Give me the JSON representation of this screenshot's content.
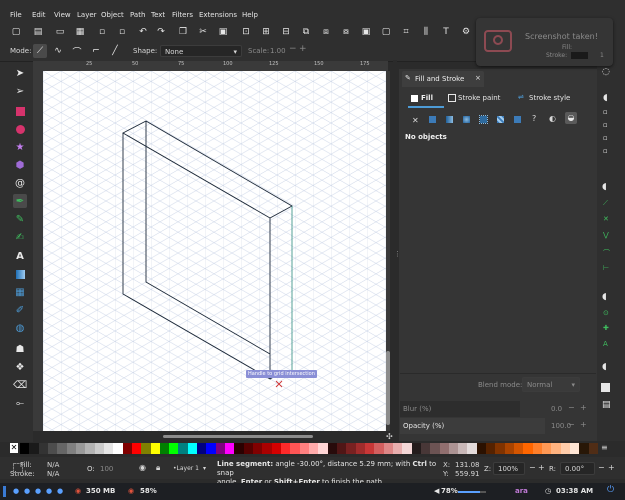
{
  "menubar": {
    "items": [
      "File",
      "Edit",
      "View",
      "Layer",
      "Object",
      "Path",
      "Text",
      "Filters",
      "Extensions",
      "Help"
    ]
  },
  "tool_controls": {
    "mode_label": "Mode:",
    "shape_label": "Shape:",
    "shape_value": "None",
    "scale_label": "Scale:",
    "scale_value": "1.00"
  },
  "ruler": {
    "top_ticks": [
      "25",
      "50",
      "75",
      "100",
      "125",
      "150",
      "175"
    ]
  },
  "canvas": {
    "tooltip": "Handle to grid intersection"
  },
  "notification": {
    "title": "Screenshot taken!",
    "fill_label": "Fill:",
    "stroke_label": "Stroke:",
    "stroke_value": "1"
  },
  "dock": {
    "tab_title": "Fill and Stroke",
    "tab_close": "×",
    "subtabs": [
      "Fill",
      "Stroke paint",
      "Stroke style"
    ],
    "no_objects": "No objects",
    "blend_label": "Blend mode:",
    "blend_value": "Normal",
    "blur_label": "Blur (%)",
    "blur_value": "0.0",
    "opacity_label": "Opacity (%)",
    "opacity_value": "100.0"
  },
  "palette": {
    "none_label": "✕",
    "colors": [
      "#000000",
      "#1a1a1a",
      "#333333",
      "#4d4d4d",
      "#666666",
      "#808080",
      "#999999",
      "#b3b3b3",
      "#cccccc",
      "#e6e6e6",
      "#ffffff",
      "#800000",
      "#ff0000",
      "#808000",
      "#ffff00",
      "#008000",
      "#00ff00",
      "#008080",
      "#00ffff",
      "#000080",
      "#0000ff",
      "#800080",
      "#ff00ff",
      "#2b0000",
      "#550000",
      "#800000",
      "#aa0000",
      "#d40000",
      "#ff2a2a",
      "#ff5555",
      "#ff8080",
      "#ffaaaa",
      "#ffd5d5",
      "#280b0b",
      "#501616",
      "#782121",
      "#a02c2c",
      "#c83737",
      "#d35f5f",
      "#de8787",
      "#e9afaf",
      "#f4d7d7",
      "#241c1c",
      "#483737",
      "#6c5353",
      "#916f6f",
      "#ac9393",
      "#c8b7b7",
      "#e3dbdb",
      "#2b1100",
      "#552200",
      "#803300",
      "#aa4400",
      "#d45500",
      "#ff6600",
      "#ff7f2a",
      "#ff9955",
      "#ffb380",
      "#ffccaa",
      "#ffe6d5",
      "#281707",
      "#502d16"
    ]
  },
  "status": {
    "fill_label": "Fill:",
    "fill_value": "N/A",
    "stroke_label": "Stroke:",
    "stroke_value": "N/A",
    "o_label": "O:",
    "o_value": "100",
    "layer_value": "•Layer 1",
    "message_bold": "Line segment:",
    "message_line1": " angle -30.00°, distance 5.29 mm; with ",
    "ctrl": "Ctrl",
    "message_line1b": " to snap",
    "message_line2a": "angle, ",
    "enter": "Enter",
    "or": " or ",
    "shift_enter": "Shift+Enter",
    "message_line2b": " to finish the path",
    "x_label": "X:",
    "x_value": "131.08",
    "y_label": "Y:",
    "y_value": "559.91",
    "z_label": "Z:",
    "zoom_value": "100%",
    "r_label": "R:",
    "rotation_value": "0.00°"
  },
  "taskbar": {
    "mem": "350 MB",
    "cpu": "58%",
    "volume": "78%",
    "layout": "ara",
    "time": "03:38 AM"
  },
  "colors": {
    "accent": "#4d9bd6",
    "canvas": "#ffffff",
    "grid": "#c9d3e6",
    "path": "#1d2a3a",
    "path_active": "#2b8a7d"
  }
}
